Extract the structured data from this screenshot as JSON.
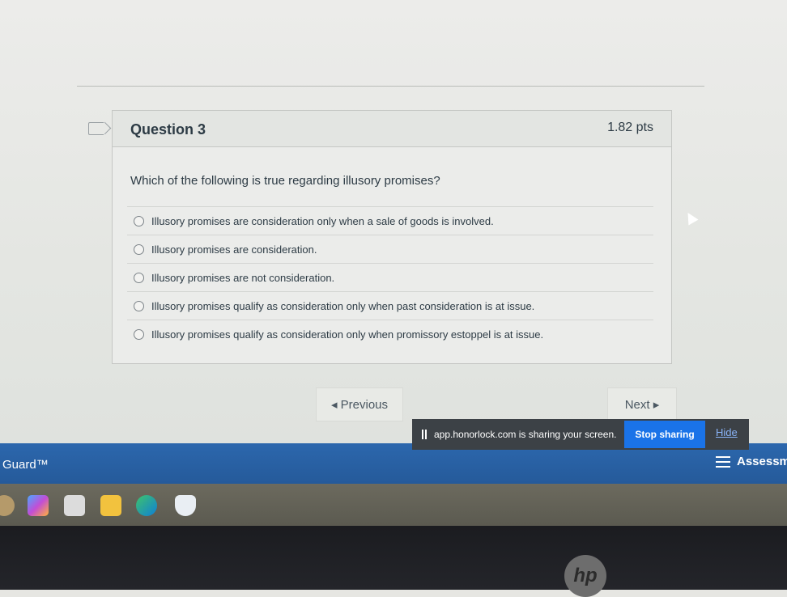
{
  "question": {
    "title": "Question 3",
    "points": "1.82 pts",
    "text": "Which of the following is true regarding illusory promises?",
    "answers": [
      "Illusory promises are consideration only when a sale of goods is involved.",
      "Illusory promises are consideration.",
      "Illusory promises are not consideration.",
      "Illusory promises qualify as consideration only when past consideration is at issue.",
      "Illusory promises qualify as consideration only when promissory estoppel is at issue."
    ]
  },
  "nav": {
    "previous": "◂ Previous",
    "next": "Next ▸"
  },
  "share_bar": {
    "message": "app.honorlock.com is sharing your screen.",
    "stop": "Stop sharing",
    "hide": "Hide"
  },
  "extension_bar": {
    "left_label": "Guard™",
    "right_label": "Assessm"
  },
  "device": {
    "brand": "hp"
  },
  "colors": {
    "accent": "#1a73e8",
    "extension_bar": "#2c67ad",
    "text": "#2d3b45"
  },
  "taskbar_icons": [
    "user-avatar-icon",
    "copilot-icon",
    "store-icon",
    "file-explorer-icon",
    "edge-browser-icon",
    "honorlock-shield-icon"
  ]
}
